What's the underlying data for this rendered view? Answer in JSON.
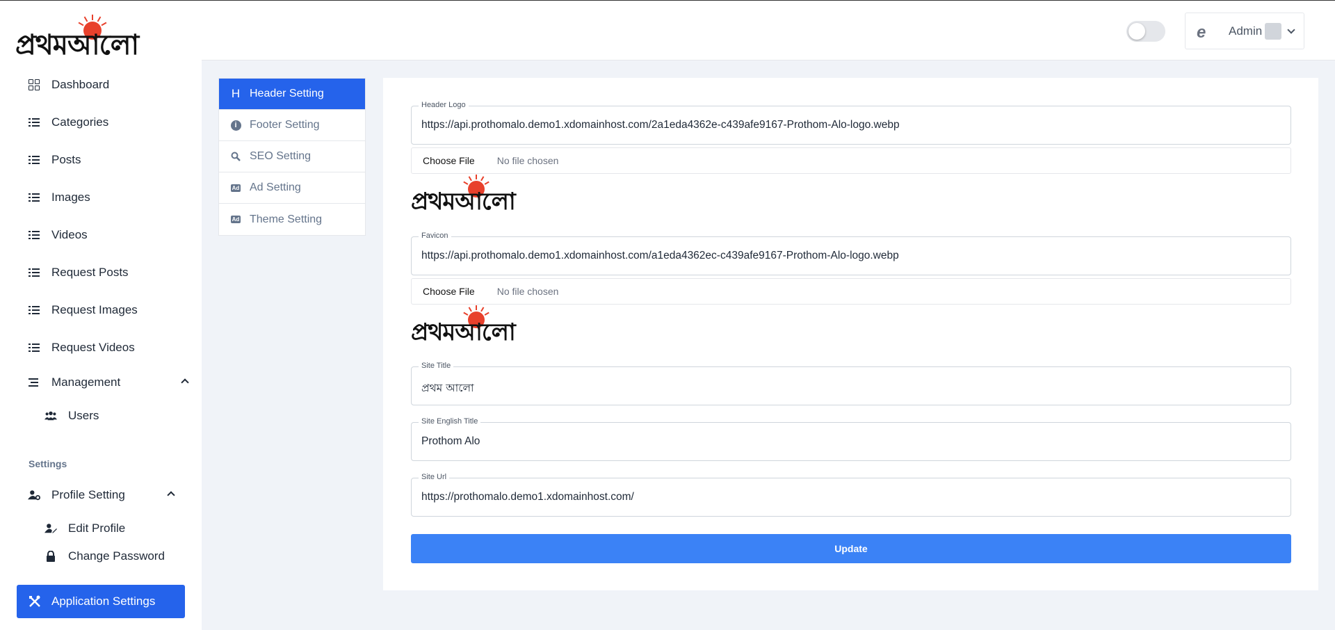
{
  "brand": {
    "logo_text": "প্রথমআলো",
    "logo_accent": "#e8412c",
    "primary_color": "#2563eb"
  },
  "sidebar": {
    "items": [
      {
        "label": "Dashboard",
        "icon": "grid-icon"
      },
      {
        "label": "Categories",
        "icon": "list-icon"
      },
      {
        "label": "Posts",
        "icon": "list-icon"
      },
      {
        "label": "Images",
        "icon": "list-icon"
      },
      {
        "label": "Videos",
        "icon": "list-icon"
      },
      {
        "label": "Request Posts",
        "icon": "list-icon"
      },
      {
        "label": "Request Images",
        "icon": "list-icon"
      },
      {
        "label": "Request Videos",
        "icon": "list-icon"
      }
    ],
    "management": {
      "label": "Management",
      "children": [
        {
          "label": "Users",
          "icon": "users-icon"
        }
      ]
    },
    "settings_section": "Settings",
    "profile": {
      "label": "Profile Setting",
      "children": [
        {
          "label": "Edit Profile",
          "icon": "user-edit-icon"
        },
        {
          "label": "Change Password",
          "icon": "lock-icon"
        }
      ]
    },
    "app_settings": {
      "label": "Application Settings",
      "icon": "tools-icon"
    }
  },
  "topbar": {
    "brand_icon": "edge-icon",
    "user_name": "Admin"
  },
  "tabs": [
    {
      "label": "Header Setting",
      "icon": "H",
      "active": true
    },
    {
      "label": "Footer Setting",
      "icon": "i",
      "active": false
    },
    {
      "label": "SEO Setting",
      "icon": "search-icon",
      "active": false
    },
    {
      "label": "Ad Setting",
      "icon": "Ad",
      "active": false
    },
    {
      "label": "Theme Setting",
      "icon": "Ad",
      "active": false
    }
  ],
  "form": {
    "header_logo": {
      "label": "Header Logo",
      "value": "https://api.prothomalo.demo1.xdomainhost.com/2a1eda4362e-c439afe9167-Prothom-Alo-logo.webp"
    },
    "favicon": {
      "label": "Favicon",
      "value": "https://api.prothomalo.demo1.xdomainhost.com/a1eda4362ec-c439afe9167-Prothom-Alo-logo.webp"
    },
    "file_button": "Choose File",
    "file_status": "No file chosen",
    "site_title": {
      "label": "Site Title",
      "value": "প্রথম আলো"
    },
    "site_english_title": {
      "label": "Site English Title",
      "value": "Prothom Alo"
    },
    "site_url": {
      "label": "Site Url",
      "value": "https://prothomalo.demo1.xdomainhost.com/"
    },
    "submit": "Update"
  }
}
